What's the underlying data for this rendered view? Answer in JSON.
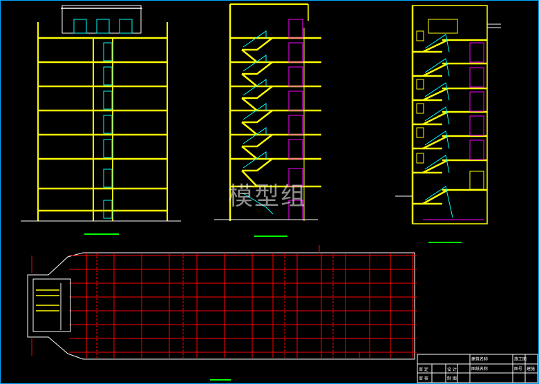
{
  "watermark": "模型组",
  "title_block": {
    "row1_a": "建筑名称",
    "row1_b": "施工图",
    "row2_a": "图纸名称",
    "row2_b": "图号",
    "row2_c": "建施",
    "row3_a": "审 定",
    "row3_b": "设 计",
    "row4_a": "审 核",
    "row4_b": "制 图"
  },
  "colors": {
    "background": "#000000",
    "wall": "#ffff00",
    "stair": "#00ffff",
    "door": "#ff00ff",
    "grid": "#ff0000",
    "label_bar": "#00ff00",
    "frame": "#00a8ff"
  }
}
